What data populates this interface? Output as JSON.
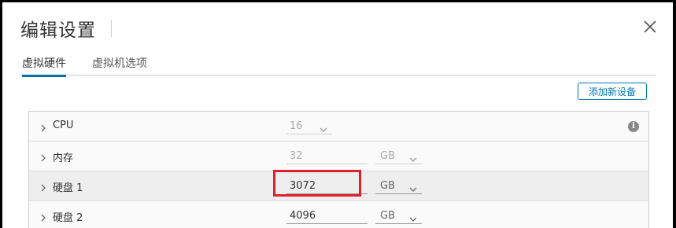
{
  "dialog": {
    "title": "编辑设置"
  },
  "tabs": [
    {
      "label": "虚拟硬件",
      "active": true
    },
    {
      "label": "虚拟机选项",
      "active": false
    }
  ],
  "toolbar": {
    "add_device_label": "添加新设备"
  },
  "rows": [
    {
      "label": "CPU",
      "value": "16",
      "unit": "",
      "value_disabled": true
    },
    {
      "label": "内存",
      "value": "32",
      "unit": "GB",
      "value_disabled": true
    },
    {
      "label": "硬盘 1",
      "value": "3072",
      "unit": "GB",
      "value_disabled": false,
      "highlighted": true
    },
    {
      "label": "硬盘 2",
      "value": "4096",
      "unit": "GB",
      "value_disabled": false
    }
  ],
  "colors": {
    "accent": "#0072a3",
    "highlight": "#e0202a"
  }
}
